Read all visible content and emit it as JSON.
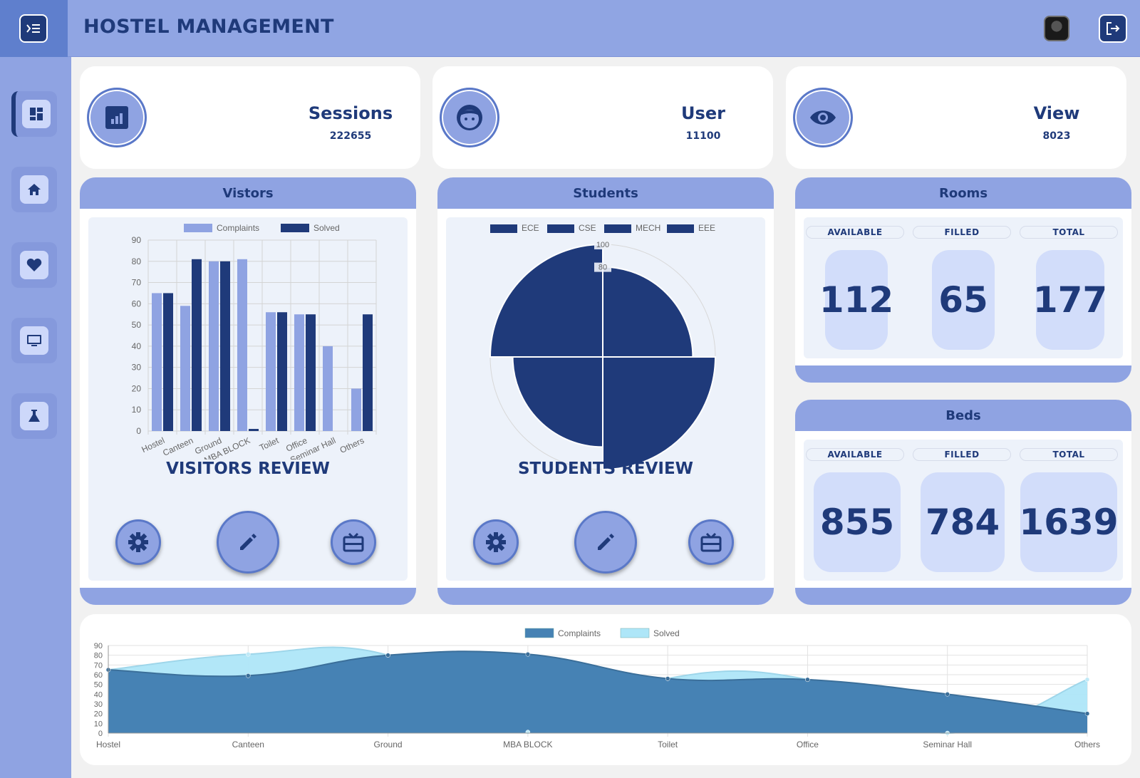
{
  "header": {
    "title": "HOSTEL MANAGEMENT"
  },
  "sidebar": {
    "items": [
      "dashboard",
      "home",
      "favorites",
      "monitor",
      "lab"
    ]
  },
  "stats": [
    {
      "title": "Sessions",
      "value": "222655",
      "icon": "bar-chart-icon"
    },
    {
      "title": "User",
      "value": "11100",
      "icon": "face-icon"
    },
    {
      "title": "View",
      "value": "8023",
      "icon": "eye-icon"
    }
  ],
  "visitors": {
    "title": "Vistors",
    "review": "VISITORS REVIEW"
  },
  "students": {
    "title": "Students",
    "review": "STUDENTS REVIEW"
  },
  "rooms": {
    "title": "Rooms",
    "labels": {
      "available": "AVAILABLE",
      "filled": "FILLED",
      "total": "TOTAL"
    },
    "available": "112",
    "filled": "65",
    "total": "177"
  },
  "beds": {
    "title": "Beds",
    "labels": {
      "available": "AVAILABLE",
      "filled": "FILLED",
      "total": "TOTAL"
    },
    "available": "855",
    "filled": "784",
    "total": "1639"
  },
  "colors": {
    "primary": "#1f3a7a",
    "light": "#8fa3e2",
    "area_dark": "#4682b4",
    "area_light": "#aee6f8"
  },
  "chart_data": [
    {
      "type": "bar",
      "categories": [
        "Hostel",
        "Canteen",
        "Ground",
        "MBA BLOCK",
        "Toilet",
        "Office",
        "Seminar Hall",
        "Others"
      ],
      "series": [
        {
          "name": "Complaints",
          "values": [
            65,
            59,
            80,
            81,
            56,
            55,
            40,
            20
          ],
          "color": "#8fa3e2"
        },
        {
          "name": "Solved",
          "values": [
            65,
            81,
            80,
            1,
            56,
            55,
            0,
            55
          ],
          "color": "#1f3a7a"
        }
      ],
      "ylim": [
        0,
        90
      ],
      "yticks": [
        0,
        10,
        20,
        30,
        40,
        50,
        60,
        70,
        80,
        90
      ],
      "legend": "top"
    },
    {
      "type": "polarArea",
      "categories": [
        "ECE",
        "CSE",
        "MECH",
        "EEE"
      ],
      "values": [
        80,
        100,
        80,
        100
      ],
      "rlim": [
        0,
        100
      ],
      "rticks": [
        "100",
        "80"
      ],
      "color": "#1f3a7a",
      "legend": "top"
    },
    {
      "type": "area",
      "categories": [
        "Hostel",
        "Canteen",
        "Ground",
        "MBA BLOCK",
        "Toilet",
        "Office",
        "Seminar Hall",
        "Others"
      ],
      "series": [
        {
          "name": "Complaints",
          "values": [
            65,
            59,
            80,
            81,
            56,
            55,
            40,
            20
          ],
          "color": "#4682b4"
        },
        {
          "name": "Solved",
          "values": [
            65,
            81,
            80,
            1,
            56,
            55,
            0,
            55
          ],
          "color": "#aee6f8"
        }
      ],
      "ylim": [
        0,
        90
      ],
      "yticks": [
        0,
        10,
        20,
        30,
        40,
        50,
        60,
        70,
        80,
        90
      ],
      "legend": "top"
    }
  ]
}
